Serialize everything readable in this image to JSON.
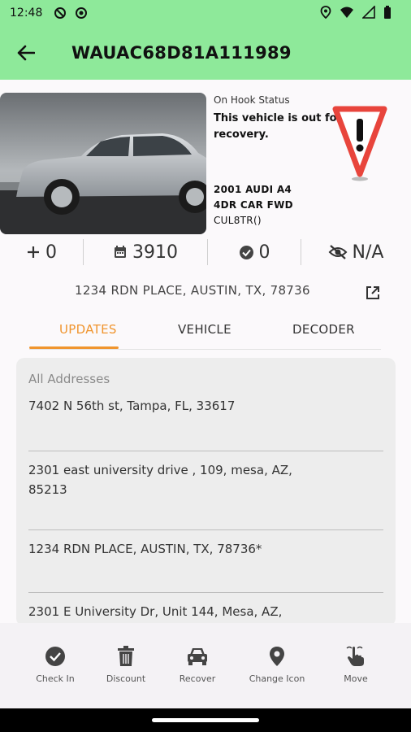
{
  "status_bar": {
    "time": "12:48"
  },
  "app_bar": {
    "title": "WAUAC68D81A111989"
  },
  "vehicle": {
    "hook_status_label": "On Hook Status",
    "hook_status_value": "This vehicle is out for recovery.",
    "year_make_model": "2001 AUDI A4",
    "body": "4DR CAR FWD",
    "trim": "CUL8TR()"
  },
  "stats": [
    {
      "icon": "plus-icon",
      "value": "0"
    },
    {
      "icon": "calendar-icon",
      "value": "3910"
    },
    {
      "icon": "check-circle-icon",
      "value": "0"
    },
    {
      "icon": "eye-off-icon",
      "value": "N/A"
    }
  ],
  "address": {
    "main": "1234 RDN PLACE, AUSTIN, TX, 78736"
  },
  "tabs": [
    {
      "label": "UPDATES",
      "active": true
    },
    {
      "label": "VEHICLE",
      "active": false
    },
    {
      "label": "DECODER",
      "active": false
    }
  ],
  "addresses_card": {
    "heading": "All Addresses",
    "items": [
      "7402 N 56th st, Tampa, FL, 33617",
      "2301 east university drive , 109, mesa, AZ,",
      "85213",
      "1234 RDN PLACE, AUSTIN, TX, 78736*",
      "2301 E University Dr, Unit 144, Mesa, AZ,"
    ]
  },
  "bottom_nav": [
    {
      "label": "Check In",
      "icon": "check-circle-icon"
    },
    {
      "label": "Discount",
      "icon": "trash-icon"
    },
    {
      "label": "Recover",
      "icon": "car-icon"
    },
    {
      "label": "Change Icon",
      "icon": "location-pin-icon"
    },
    {
      "label": "Move",
      "icon": "hand-pointer-icon"
    }
  ],
  "colors": {
    "accent": "#f0952e",
    "app_bar": "#8ee99a",
    "warning": "#e8453c"
  }
}
